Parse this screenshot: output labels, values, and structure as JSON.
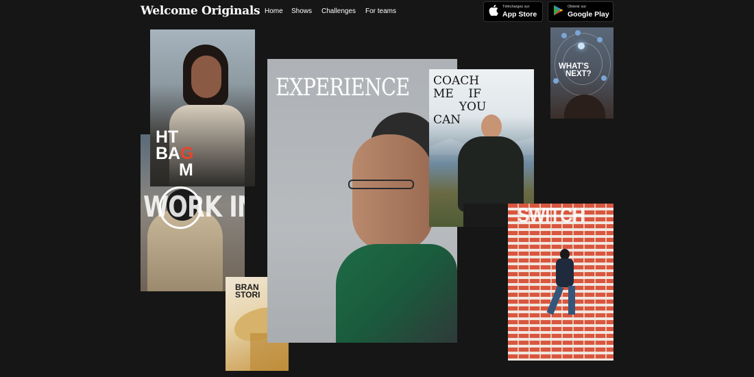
{
  "header": {
    "brand": "Welcome Originals",
    "nav": [
      "Home",
      "Shows",
      "Challenges",
      "For teams"
    ],
    "app_store": {
      "small": "Téléchargez sur",
      "big": "App Store"
    },
    "google_play": {
      "small": "Obtenir sur",
      "big": "Google Play"
    }
  },
  "cards": {
    "htbag": {
      "line1": "HT",
      "line2a": "BA",
      "line2b": "G",
      "line3": "M"
    },
    "work_in": {
      "title": "WORK IN"
    },
    "brand_stories": {
      "line1": "BRAN",
      "line2": "STORI"
    },
    "experience": {
      "title": "EXPERIENCE"
    },
    "coach": {
      "line1": "COACH",
      "line2": "ME    IF",
      "line3": "       YOU",
      "line4": "CAN"
    },
    "whats_next": {
      "line1": "WHAT'S",
      "line2": "NEXT?"
    },
    "switch": {
      "title": "SWITCH"
    }
  },
  "colors": {
    "background": "#161616",
    "accent_red": "#e8452b"
  }
}
